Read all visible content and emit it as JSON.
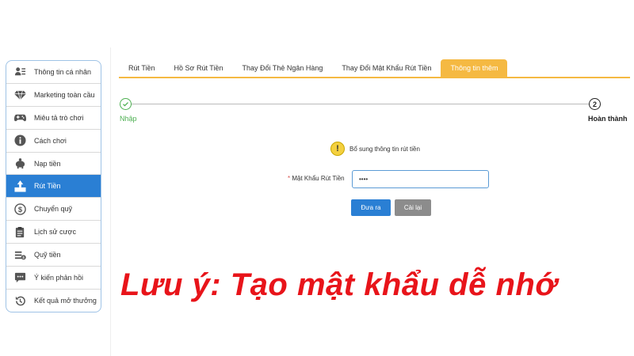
{
  "sidebar": {
    "items": [
      {
        "label": "Thông tin cá nhân",
        "icon": "id-card-icon"
      },
      {
        "label": "Marketing toàn cầu",
        "icon": "diamond-icon"
      },
      {
        "label": "Miêu tả trò chơi",
        "icon": "gamepad-icon"
      },
      {
        "label": "Cách chơi",
        "icon": "info-icon"
      },
      {
        "label": "Nạp tiền",
        "icon": "piggy-bank-icon"
      },
      {
        "label": "Rút Tiền",
        "icon": "withdraw-icon"
      },
      {
        "label": "Chuyển quỹ",
        "icon": "dollar-circle-icon"
      },
      {
        "label": "Lịch sử cược",
        "icon": "clipboard-icon"
      },
      {
        "label": "Quỹ tiền",
        "icon": "money-icon"
      },
      {
        "label": "Ý kiến phản hồi",
        "icon": "chat-icon"
      },
      {
        "label": "Kết quả mở thưởng",
        "icon": "history-icon"
      }
    ],
    "active_index": 5
  },
  "tabs": [
    {
      "label": "Rút Tiền"
    },
    {
      "label": "Hồ Sơ Rút Tiền"
    },
    {
      "label": "Thay Đổi Thẻ Ngân Hàng"
    },
    {
      "label": "Thay Đổi Mật Khẩu Rút Tiền"
    },
    {
      "label": "Thông tin thêm"
    }
  ],
  "active_tab": 4,
  "progress": {
    "step1_label": "Nhập",
    "step2_number": "2",
    "step2_label": "Hoàn thành"
  },
  "notice": {
    "icon_text": "!",
    "text": "Bổ sung thông tin rút tiền"
  },
  "form": {
    "required_mark": "*",
    "password_label": "Mật Khẩu Rút Tiền",
    "password_value": "••••",
    "submit_label": "Đưa ra",
    "reset_label": "Cài lại"
  },
  "caption": "Lưu ý: Tạo mật khẩu dễ nhớ",
  "colors": {
    "accent_blue": "#2a7fd4",
    "tab_orange": "#f5b942",
    "success_green": "#4caf50",
    "caption_red": "#e8141a"
  }
}
